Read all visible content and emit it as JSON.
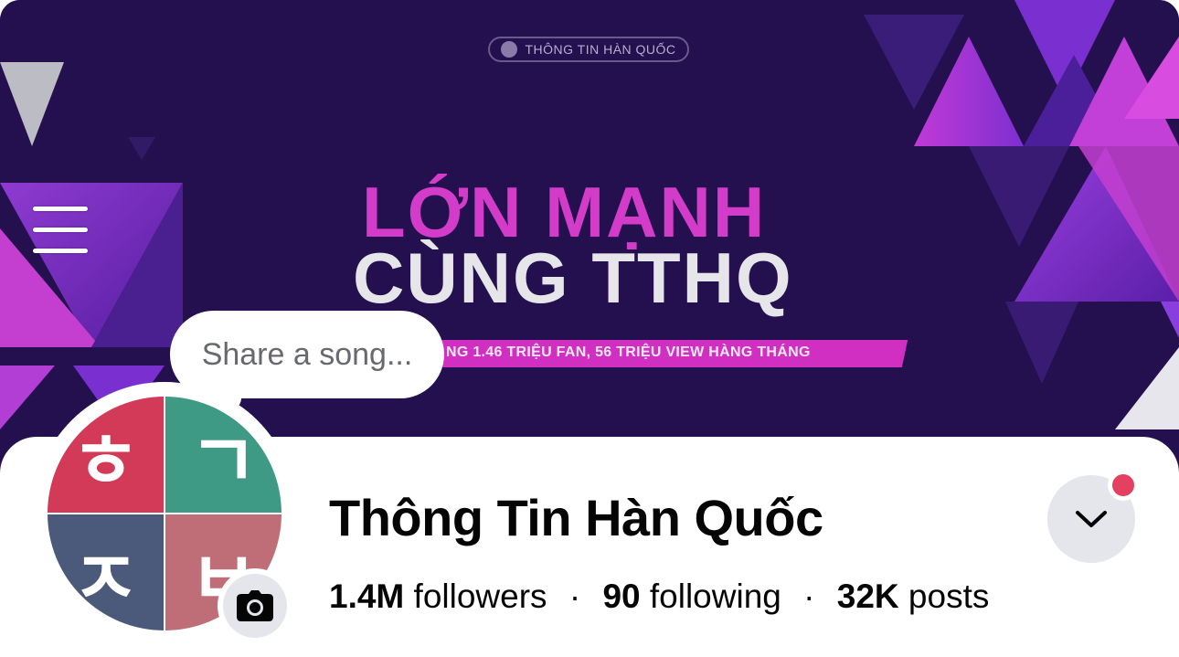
{
  "cover": {
    "brand_label": "THÔNG TIN HÀN QUỐC",
    "headline_line1": "LỚN MẠNH",
    "headline_line2": "CÙNG TTHQ",
    "ribbon_text": "NG 1.46 TRIỆU FAN, 56 TRIỆU VIEW HÀNG THÁNG"
  },
  "menu": {
    "icon": "hamburger-menu-icon"
  },
  "share_bubble": {
    "placeholder": "Share a song..."
  },
  "avatar": {
    "glyphs": [
      "ㅎ",
      "ㄱ",
      "ㅈ",
      "ㅂ"
    ],
    "colors": [
      "#d23a58",
      "#3e9a84",
      "#4b5a7a",
      "#bf6e77"
    ]
  },
  "profile": {
    "name": "Thông Tin Hàn Quốc",
    "followers_count": "1.4M",
    "followers_label": "followers",
    "following_count": "90",
    "following_label": "following",
    "posts_count": "32K",
    "posts_label": "posts",
    "separator": "·"
  },
  "icons": {
    "camera": "camera-icon",
    "dropdown": "chevron-down-icon"
  },
  "colors": {
    "cover_bg": "#24104f",
    "accent_magenta": "#d33bc9",
    "notification": "#e4405f"
  }
}
